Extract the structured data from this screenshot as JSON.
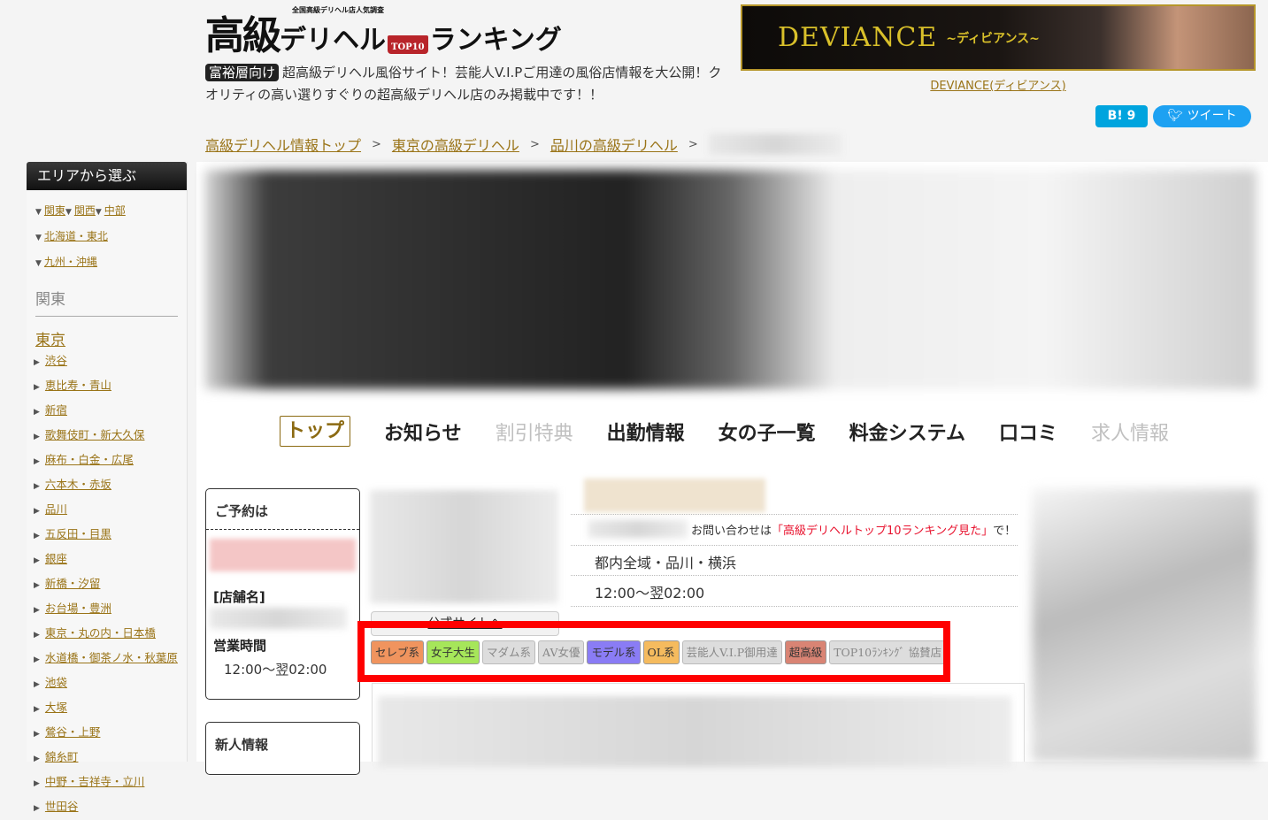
{
  "header": {
    "logo": {
      "main": "高級",
      "kana": "デリヘル",
      "crown": "TOP10",
      "tail": "ランキング",
      "sub": "全国高級デリヘル店人気調査"
    },
    "badge": "富裕層向け",
    "tagline": "超高級デリヘル風俗サイト！芸能人V.I.Pご用達の風俗店情報を大公開！クオリティの高い選りすぐりの超高級デリヘル店のみ掲載中です！！",
    "banner": {
      "title": "DEVIANCE",
      "subtitle": "~ディビアンス~",
      "link": "DEVIANCE(ディビアンス)"
    },
    "share": {
      "hatena": "B! 9",
      "tweet": "ツイート"
    }
  },
  "breadcrumb": [
    "高級デリヘル情報トップ",
    "東京の高級デリヘル",
    "品川の高級デリヘル"
  ],
  "breadcrumb_sep": ">",
  "sidebar": {
    "title": "エリアから選ぶ",
    "regions": [
      "関東",
      "関西",
      "中部",
      "北海道・東北",
      "九州・沖縄"
    ],
    "section": "関東",
    "city": "東京",
    "areas": [
      "渋谷",
      "恵比寿・青山",
      "新宿",
      "歌舞伎町・新大久保",
      "麻布・白金・広尾",
      "六本木・赤坂",
      "品川",
      "五反田・目黒",
      "銀座",
      "新橋・汐留",
      "お台場・豊洲",
      "東京・丸の内・日本橋",
      "水道橋・御茶ノ水・秋葉原",
      "池袋",
      "大塚",
      "鶯谷・上野",
      "錦糸町",
      "中野・吉祥寺・立川",
      "世田谷"
    ]
  },
  "nav": [
    {
      "label": "トップ",
      "state": "active"
    },
    {
      "label": "お知らせ",
      "state": "normal"
    },
    {
      "label": "割引特典",
      "state": "disabled"
    },
    {
      "label": "出勤情報",
      "state": "normal"
    },
    {
      "label": "女の子一覧",
      "state": "normal"
    },
    {
      "label": "料金システム",
      "state": "normal"
    },
    {
      "label": "口コミ",
      "state": "normal"
    },
    {
      "label": "求人情報",
      "state": "disabled"
    }
  ],
  "reserve": {
    "title": "ご予約は",
    "shop_label": "[店舗名]",
    "hours_label": "営業時間",
    "hours": "12:00〜翌02:00"
  },
  "new_info": {
    "title": "新人情報"
  },
  "shop": {
    "inquiry_prefix": "お問い合わせは",
    "inquiry_phrase": "「高級デリヘルトップ10ランキング見た」",
    "inquiry_suffix": "で！",
    "area": "都内全域・品川・横浜",
    "hours": "12:00〜翌02:00",
    "site_button": "公式サイトへ"
  },
  "tags": [
    {
      "label": "セレブ系",
      "active": true,
      "color": "#f0945e"
    },
    {
      "label": "女子大生",
      "active": true,
      "color": "#a6e65a"
    },
    {
      "label": "マダム系",
      "active": false,
      "color": "#dddddd"
    },
    {
      "label": "AV女優",
      "active": false,
      "color": "#dddddd"
    },
    {
      "label": "モデル系",
      "active": true,
      "color": "#8a7cf5"
    },
    {
      "label": "OL系",
      "active": true,
      "color": "#f5bb5e"
    },
    {
      "label": "芸能人V.I.P御用達",
      "active": false,
      "color": "#dddddd"
    },
    {
      "label": "超高級",
      "active": true,
      "color": "#d98474"
    },
    {
      "label": "TOP10ﾗﾝｷﾝｸﾞ 協賛店",
      "active": false,
      "color": "#dddddd"
    }
  ],
  "colors": {
    "link": "#9a7418",
    "highlight": "#ff0000",
    "inquiry_red": "#e8112d"
  }
}
